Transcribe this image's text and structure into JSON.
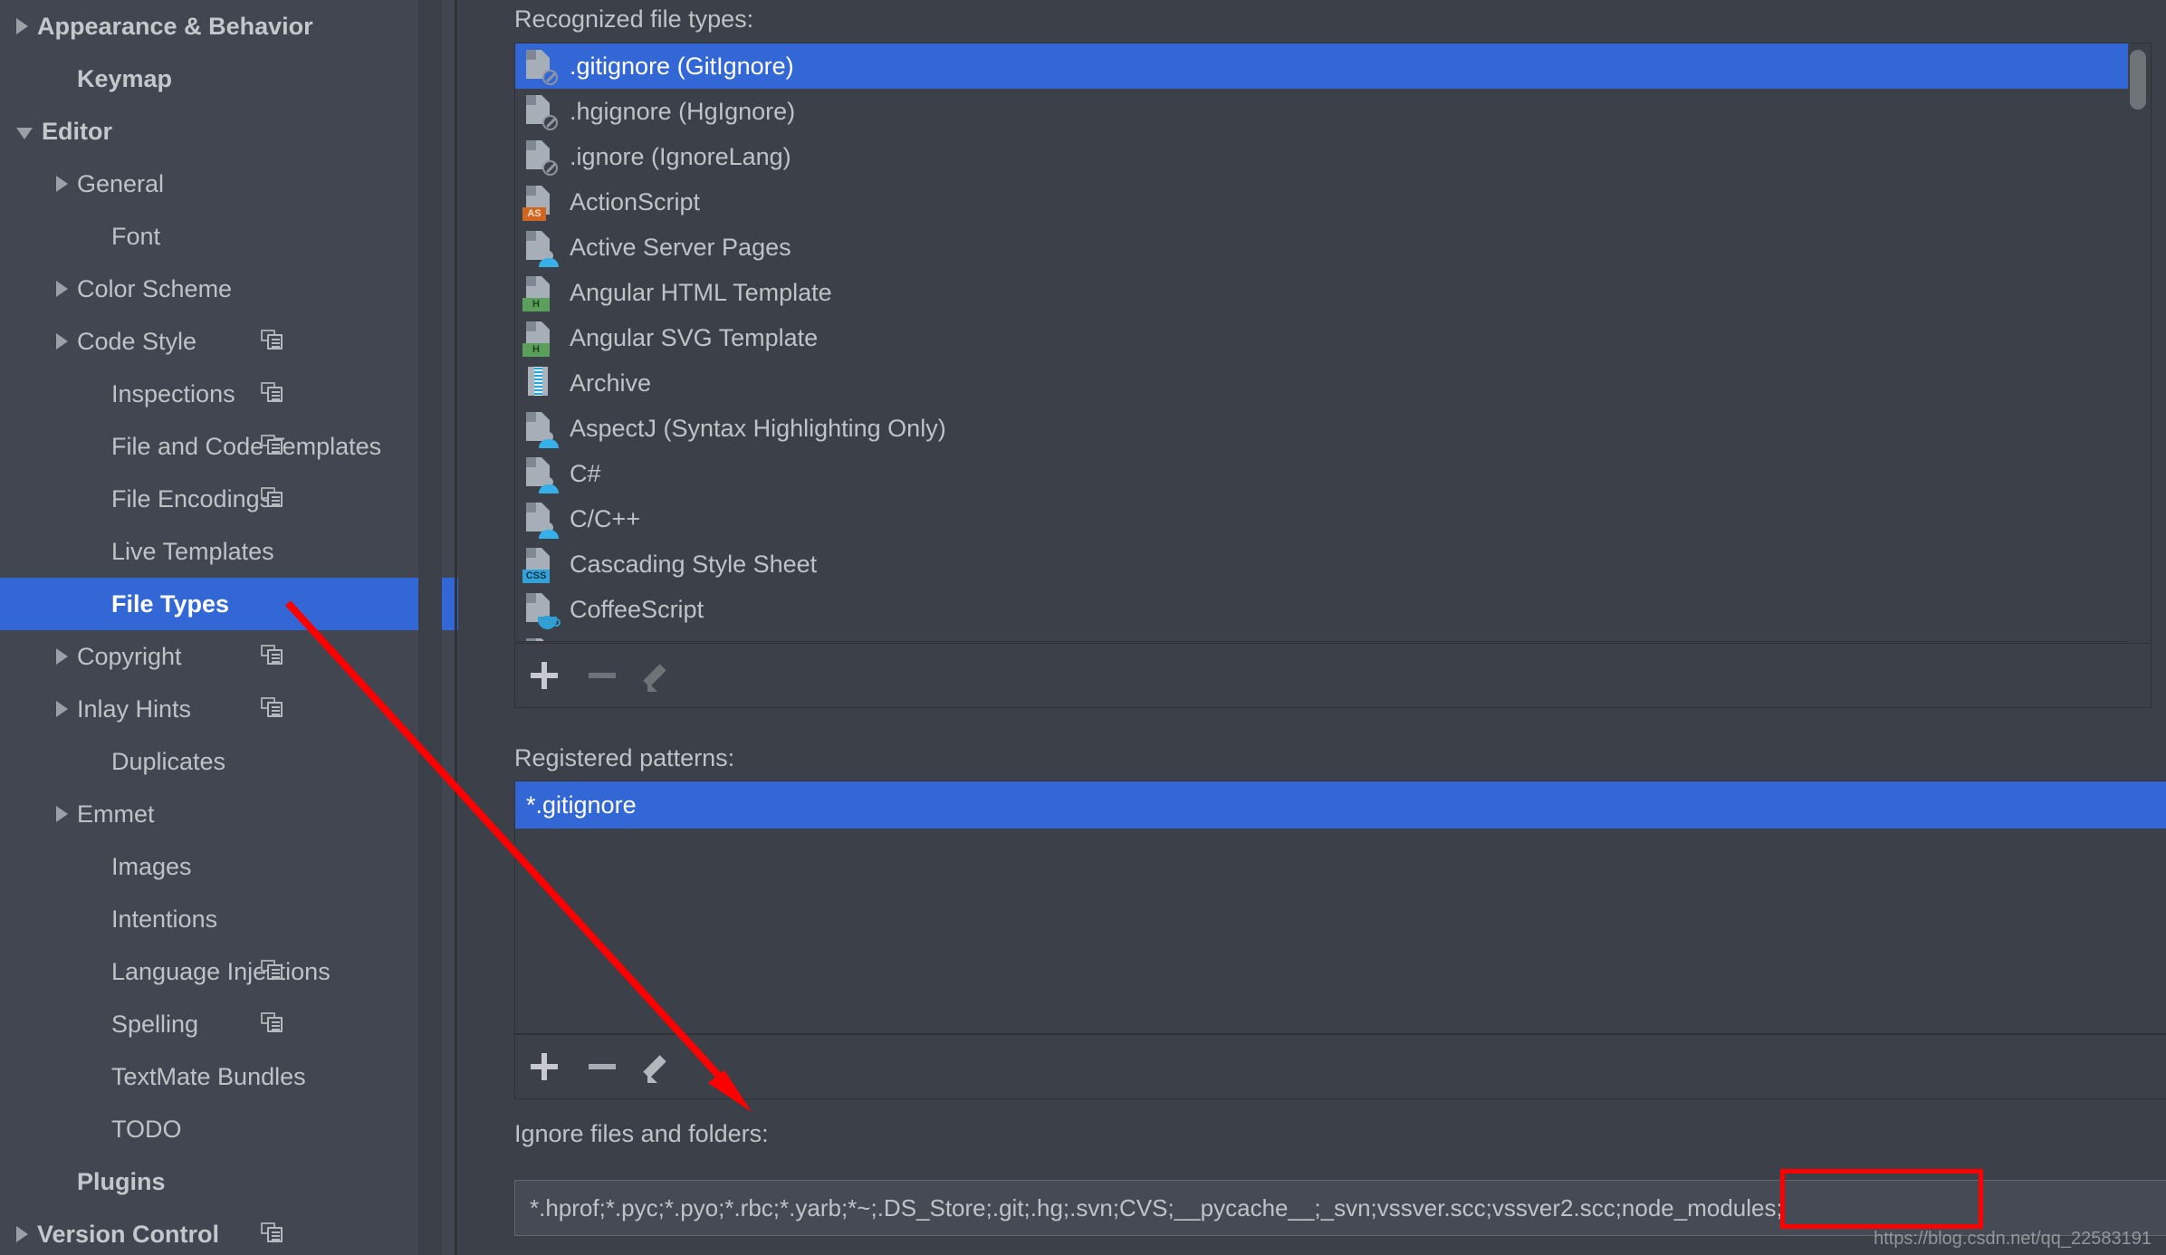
{
  "sidebar": {
    "items": [
      {
        "label": "Appearance & Behavior",
        "level": 0,
        "arrow": "right",
        "bold": true,
        "selected": false,
        "copy": false
      },
      {
        "label": "Keymap",
        "level": 1,
        "arrow": "none",
        "bold": true,
        "selected": false,
        "copy": false
      },
      {
        "label": "Editor",
        "level": 0,
        "arrow": "down",
        "bold": true,
        "selected": false,
        "copy": false
      },
      {
        "label": "General",
        "level": 1,
        "arrow": "right",
        "bold": false,
        "selected": false,
        "copy": false
      },
      {
        "label": "Font",
        "level": 2,
        "arrow": "none",
        "bold": false,
        "selected": false,
        "copy": false
      },
      {
        "label": "Color Scheme",
        "level": 1,
        "arrow": "right",
        "bold": false,
        "selected": false,
        "copy": false
      },
      {
        "label": "Code Style",
        "level": 1,
        "arrow": "right",
        "bold": false,
        "selected": false,
        "copy": true
      },
      {
        "label": "Inspections",
        "level": 2,
        "arrow": "none",
        "bold": false,
        "selected": false,
        "copy": true
      },
      {
        "label": "File and Code Templates",
        "level": 2,
        "arrow": "none",
        "bold": false,
        "selected": false,
        "copy": true
      },
      {
        "label": "File Encodings",
        "level": 2,
        "arrow": "none",
        "bold": false,
        "selected": false,
        "copy": true
      },
      {
        "label": "Live Templates",
        "level": 2,
        "arrow": "none",
        "bold": false,
        "selected": false,
        "copy": false
      },
      {
        "label": "File Types",
        "level": 2,
        "arrow": "none",
        "bold": false,
        "selected": true,
        "copy": false
      },
      {
        "label": "Copyright",
        "level": 1,
        "arrow": "right",
        "bold": false,
        "selected": false,
        "copy": true
      },
      {
        "label": "Inlay Hints",
        "level": 1,
        "arrow": "right",
        "bold": false,
        "selected": false,
        "copy": true
      },
      {
        "label": "Duplicates",
        "level": 2,
        "arrow": "none",
        "bold": false,
        "selected": false,
        "copy": false
      },
      {
        "label": "Emmet",
        "level": 1,
        "arrow": "right",
        "bold": false,
        "selected": false,
        "copy": false
      },
      {
        "label": "Images",
        "level": 2,
        "arrow": "none",
        "bold": false,
        "selected": false,
        "copy": false
      },
      {
        "label": "Intentions",
        "level": 2,
        "arrow": "none",
        "bold": false,
        "selected": false,
        "copy": false
      },
      {
        "label": "Language Injections",
        "level": 2,
        "arrow": "none",
        "bold": false,
        "selected": false,
        "copy": true
      },
      {
        "label": "Spelling",
        "level": 2,
        "arrow": "none",
        "bold": false,
        "selected": false,
        "copy": true
      },
      {
        "label": "TextMate Bundles",
        "level": 2,
        "arrow": "none",
        "bold": false,
        "selected": false,
        "copy": false
      },
      {
        "label": "TODO",
        "level": 2,
        "arrow": "none",
        "bold": false,
        "selected": false,
        "copy": false
      },
      {
        "label": "Plugins",
        "level": 1,
        "arrow": "none",
        "bold": true,
        "selected": false,
        "copy": false
      },
      {
        "label": "Version Control",
        "level": 0,
        "arrow": "right",
        "bold": true,
        "selected": false,
        "copy": true
      }
    ]
  },
  "panel": {
    "recognized_label": "Recognized file types:",
    "registered_label": "Registered patterns:",
    "ignore_label": "Ignore files and folders:",
    "file_types": [
      {
        "label": ".gitignore (GitIgnore)",
        "icon": "file-noicon-icon",
        "selected": true
      },
      {
        "label": ".hgignore (HgIgnore)",
        "icon": "file-noicon-icon",
        "selected": false
      },
      {
        "label": ".ignore (IgnoreLang)",
        "icon": "file-noicon-icon",
        "selected": false
      },
      {
        "label": "ActionScript",
        "icon": "file-as-badge-icon",
        "selected": false
      },
      {
        "label": "Active Server Pages",
        "icon": "file-person-icon",
        "selected": false
      },
      {
        "label": "Angular HTML Template",
        "icon": "file-h-badge-icon",
        "selected": false
      },
      {
        "label": "Angular SVG Template",
        "icon": "file-h-badge-icon",
        "selected": false
      },
      {
        "label": "Archive",
        "icon": "zip-archive-icon",
        "selected": false
      },
      {
        "label": "AspectJ (Syntax Highlighting Only)",
        "icon": "file-person-icon",
        "selected": false
      },
      {
        "label": "C#",
        "icon": "file-person-icon",
        "selected": false
      },
      {
        "label": "C/C++",
        "icon": "file-person-icon",
        "selected": false
      },
      {
        "label": "Cascading Style Sheet",
        "icon": "file-css-badge-icon",
        "selected": false
      },
      {
        "label": "CoffeeScript",
        "icon": "file-coffee-icon",
        "selected": false
      }
    ],
    "types_toolbar": {
      "add_label": "+",
      "remove_label": "−",
      "edit_label": "edit",
      "add_enabled": true,
      "remove_enabled": false,
      "edit_enabled": false
    },
    "patterns": [
      {
        "label": "*.gitignore",
        "selected": true
      }
    ],
    "patterns_toolbar": {
      "add_label": "+",
      "remove_label": "−",
      "edit_label": "edit",
      "add_enabled": true,
      "remove_enabled": true,
      "edit_enabled": true
    },
    "ignore_value": "*.hprof;*.pyc;*.pyo;*.rbc;*.yarb;*~;.DS_Store;.git;.hg;.svn;CVS;__pycache__;_svn;vssver.scc;vssver2.scc;node_modules;"
  },
  "annotation": {
    "highlight_color": "#ff0000",
    "watermark": "https://blog.csdn.net/qq_22583191"
  }
}
